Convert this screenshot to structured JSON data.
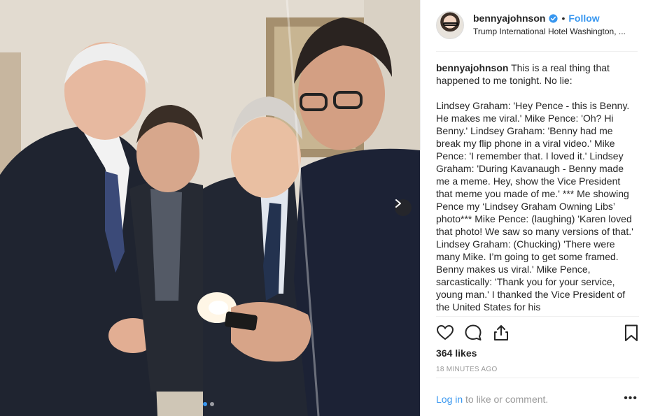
{
  "post": {
    "photo_description": "",
    "carousel": {
      "total": 2,
      "active": 1
    }
  },
  "header": {
    "username": "bennyajohnson",
    "separator": "•",
    "follow_label": "Follow",
    "location": "Trump International Hotel Washington, ..."
  },
  "caption": {
    "username": "bennyajohnson",
    "text": " This is a real thing that happened to me tonight. No lie:\n\nLindsey Graham: 'Hey Pence - this is Benny. He makes me viral.' Mike Pence: 'Oh? Hi Benny.' Lindsey Graham: 'Benny had me break my flip phone in a viral video.' Mike Pence: 'I remember that. I loved it.' Lindsey Graham: 'During Kavanaugh - Benny made me a meme. Hey, show the Vice President that meme you made of me.' *** Me showing Pence my ‘Lindsey Graham Owning Libs’ photo*** Mike Pence: (laughing) 'Karen loved that photo! We saw so many versions of that.' Lindsey Graham: (Chucking) 'There were many Mike. I’m going to get some framed. Benny makes us viral.' Mike Pence, sarcastically: 'Thank you for your service, young man.' I thanked the Vice President of the United States for his"
  },
  "stats": {
    "likes": "364 likes",
    "time": "18 MINUTES AGO"
  },
  "comment_bar": {
    "login_label": "Log in",
    "rest": " to like or comment.",
    "more": "•••"
  },
  "icons": {
    "like": "heart-icon",
    "comment": "comment-bubble-icon",
    "share": "share-icon",
    "save": "bookmark-icon",
    "verified": "verified-badge-icon",
    "next": "chevron-right-icon"
  },
  "colors": {
    "accent": "#3897f0",
    "muted": "#999999",
    "text": "#262626",
    "divider": "#efefef"
  }
}
